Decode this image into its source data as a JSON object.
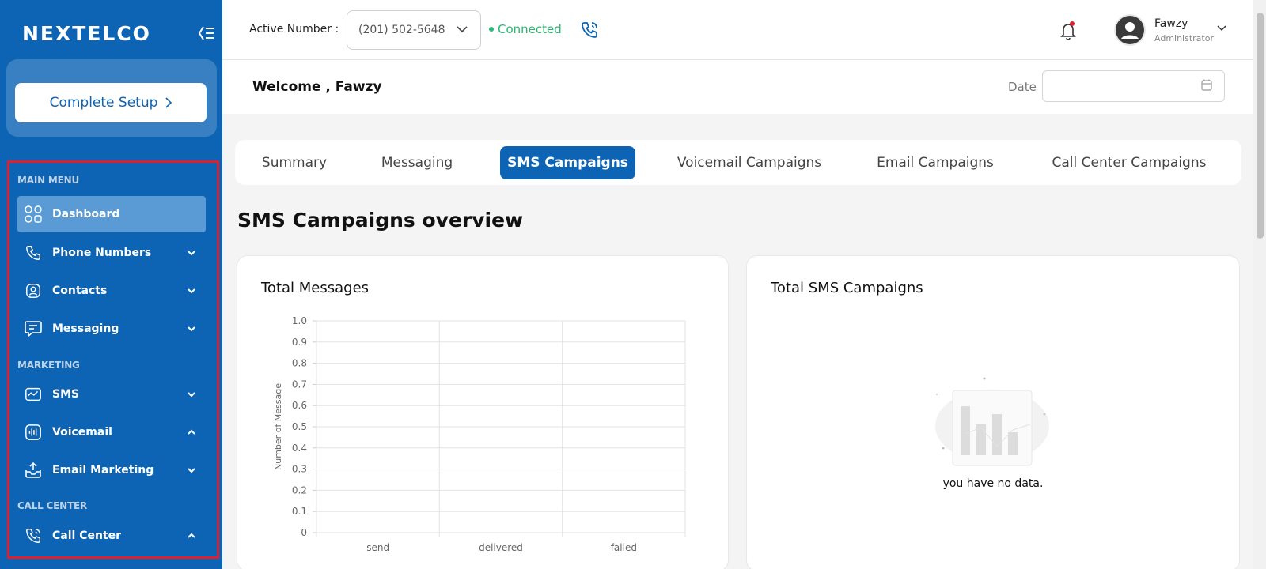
{
  "sidebar": {
    "logo": "NEXTELCO",
    "setup_label": "Complete Setup",
    "sections": {
      "main_menu": "MAIN MENU",
      "marketing": "MARKETING",
      "call_center": "CALL CENTER"
    },
    "items": [
      {
        "label": "Dashboard",
        "icon": "grid-icon",
        "active": true
      },
      {
        "label": "Phone Numbers",
        "icon": "phone-icon",
        "chevron": "down"
      },
      {
        "label": "Contacts",
        "icon": "contact-icon",
        "chevron": "down"
      },
      {
        "label": "Messaging",
        "icon": "message-icon",
        "chevron": "down"
      },
      {
        "label": "SMS",
        "icon": "sms-icon",
        "chevron": "down"
      },
      {
        "label": "Voicemail",
        "icon": "voicemail-icon",
        "chevron": "up"
      },
      {
        "label": "Email Marketing",
        "icon": "email-tray-icon",
        "chevron": "down"
      },
      {
        "label": "Call Center",
        "icon": "phone-call-icon",
        "chevron": "up"
      }
    ]
  },
  "header": {
    "active_number_label": "Active Number :",
    "active_number": "(201) 502-5648",
    "status": "Connected",
    "user_name": "Fawzy",
    "user_role": "Administrator"
  },
  "welcome": {
    "text": "Welcome , Fawzy",
    "date_label": "Date",
    "date_value": ""
  },
  "tabs": [
    "Summary",
    "Messaging",
    "SMS Campaigns",
    "Voicemail Campaigns",
    "Email Campaigns",
    "Call Center Campaigns"
  ],
  "active_tab": "SMS Campaigns",
  "overview_title": "SMS Campaigns overview",
  "cards": {
    "total_messages": "Total Messages",
    "total_campaigns": "Total SMS Campaigns",
    "no_data": "you have no data."
  },
  "colors": {
    "brand": "#0d64b4",
    "connected": "#2bb673",
    "highlight": "#e21d2c"
  },
  "chart_data": {
    "type": "bar",
    "title": "Total Messages",
    "categories": [
      "send",
      "delivered",
      "failed"
    ],
    "values": [
      0,
      0,
      0
    ],
    "ylabel": "Number of Message",
    "xlabel": "",
    "ylim": [
      0,
      1.0
    ],
    "yticks": [
      "0",
      "0.1",
      "0.2",
      "0.3",
      "0.4",
      "0.5",
      "0.6",
      "0.7",
      "0.8",
      "0.9",
      "1.0"
    ],
    "grid": true
  }
}
